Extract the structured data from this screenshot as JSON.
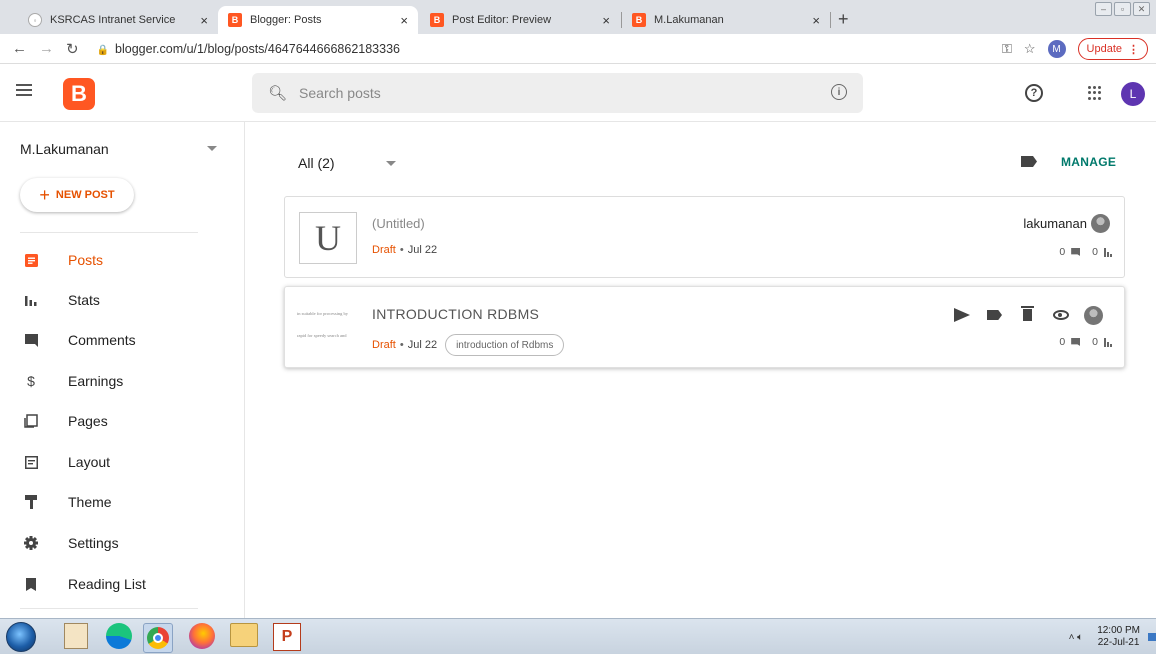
{
  "browser": {
    "tabs": [
      {
        "label": "KSRCAS Intranet Service",
        "close": "×"
      },
      {
        "label": "Blogger: Posts",
        "close": "×"
      },
      {
        "label": "Post Editor: Preview",
        "close": "×"
      },
      {
        "label": "M.Lakumanan",
        "close": "×"
      }
    ],
    "new_tab": "+",
    "url": "blogger.com/u/1/blog/posts/4647644666862183336",
    "profile_initial": "M",
    "update_label": "Update"
  },
  "header": {
    "logo_letter": "B",
    "search_placeholder": "Search posts",
    "avatar_initial": "L"
  },
  "sidebar": {
    "blog_name": "M.Lakumanan",
    "new_post_label": "NEW POST",
    "items": [
      {
        "label": "Posts",
        "icon": "posts-icon"
      },
      {
        "label": "Stats",
        "icon": "stats-icon"
      },
      {
        "label": "Comments",
        "icon": "comments-icon"
      },
      {
        "label": "Earnings",
        "icon": "dollar-icon"
      },
      {
        "label": "Pages",
        "icon": "pages-icon"
      },
      {
        "label": "Layout",
        "icon": "layout-icon"
      },
      {
        "label": "Theme",
        "icon": "theme-icon"
      },
      {
        "label": "Settings",
        "icon": "gear-icon"
      },
      {
        "label": "Reading List",
        "icon": "bookmark-icon"
      }
    ]
  },
  "main": {
    "filter_label": "All (2)",
    "manage_label": "MANAGE",
    "posts": [
      {
        "thumb_letter": "U",
        "title": "(Untitled)",
        "status": "Draft",
        "date": "Jul 22",
        "author": "lakumanan",
        "comments": "0",
        "views": "0"
      },
      {
        "thumb_line1": "in suitable for processing by",
        "thumb_line2": "rapid for speedy search and",
        "title": "INTRODUCTION RDBMS",
        "status": "Draft",
        "date": "Jul 22",
        "label": "introduction of Rdbms",
        "comments": "0",
        "views": "0"
      }
    ]
  },
  "taskbar": {
    "time": "12:00 PM",
    "date": "22-Jul-21",
    "ppt_letter": "P"
  },
  "colors": {
    "blogger_orange": "#ff5722",
    "draft_orange": "#e65100",
    "manage_teal": "#00796b",
    "avatar_purple": "#5e35b1"
  }
}
